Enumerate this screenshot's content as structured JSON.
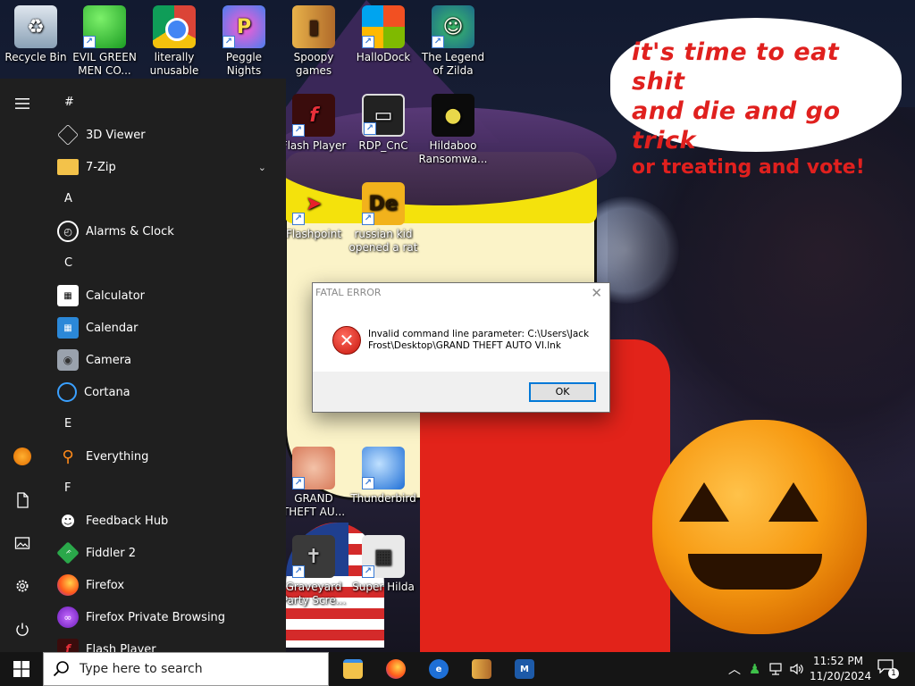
{
  "wallpaper": {
    "bubble_line1": "it's time to eat shit",
    "bubble_line2": "and die and go trick",
    "bubble_line3": "or treating and vote!",
    "accent_red": "#e0201e"
  },
  "desktop_icons": [
    {
      "label": "Recycle Bin",
      "icon": "recycle-bin-icon"
    },
    {
      "label": "EVIL GREEN MEN CO...",
      "icon": "green-men-icon"
    },
    {
      "label": "literally unusable",
      "icon": "chrome-icon"
    },
    {
      "label": "Peggle Nights Deluxe",
      "icon": "peggle-icon"
    },
    {
      "label": "Spoopy games",
      "icon": "spoopy-icon"
    },
    {
      "label": "HalloDock",
      "icon": "windows-logo-icon"
    },
    {
      "label": "The Legend of Zilda",
      "icon": "zilda-icon"
    },
    {
      "label": "Flash Player",
      "icon": "flash-icon"
    },
    {
      "label": "RDP_CnC",
      "icon": "rdp-icon"
    },
    {
      "label": "Hildaboo Ransomwa...",
      "icon": "hildaboo-icon"
    },
    {
      "label": "Flashpoint",
      "icon": "flashpoint-icon"
    },
    {
      "label": "russian kid opened a rat",
      "icon": "de-icon"
    },
    {
      "label": "GRAND THEFT AU...",
      "icon": "gta-icon"
    },
    {
      "label": "Thunderbird",
      "icon": "thunderbird-icon"
    },
    {
      "label": "Graveyard Party Scre...",
      "icon": "graveyard-icon"
    },
    {
      "label": "Super Hilda",
      "icon": "super-hilda-icon"
    }
  ],
  "start_menu": {
    "sections": [
      {
        "letter": "#",
        "apps": [
          {
            "name": "3D Viewer",
            "icon": "cube-icon"
          },
          {
            "name": "7-Zip",
            "icon": "folder-icon",
            "expandable": true
          }
        ]
      },
      {
        "letter": "A",
        "apps": [
          {
            "name": "Alarms & Clock",
            "icon": "clock-icon"
          }
        ]
      },
      {
        "letter": "C",
        "apps": [
          {
            "name": "Calculator",
            "icon": "calculator-icon"
          },
          {
            "name": "Calendar",
            "icon": "calendar-icon"
          },
          {
            "name": "Camera",
            "icon": "camera-icon"
          },
          {
            "name": "Cortana",
            "icon": "cortana-icon"
          }
        ]
      },
      {
        "letter": "E",
        "apps": [
          {
            "name": "Everything",
            "icon": "magnifier-icon"
          }
        ]
      },
      {
        "letter": "F",
        "apps": [
          {
            "name": "Feedback Hub",
            "icon": "feedback-icon"
          },
          {
            "name": "Fiddler 2",
            "icon": "fiddler-icon"
          },
          {
            "name": "Firefox",
            "icon": "firefox-icon"
          },
          {
            "name": "Firefox Private Browsing",
            "icon": "firefox-private-icon"
          },
          {
            "name": "Flash Player",
            "icon": "flash-icon"
          }
        ]
      }
    ]
  },
  "dialog": {
    "title": "FATAL ERROR",
    "message": "Invalid command line parameter: C:\\Users\\Jack Frost\\Desktop\\GRAND THEFT AUTO VI.lnk",
    "ok_label": "OK"
  },
  "taskbar": {
    "search_placeholder": "Type here to search",
    "time": "11:52 PM",
    "date": "11/20/2024",
    "notification_count": "1"
  }
}
